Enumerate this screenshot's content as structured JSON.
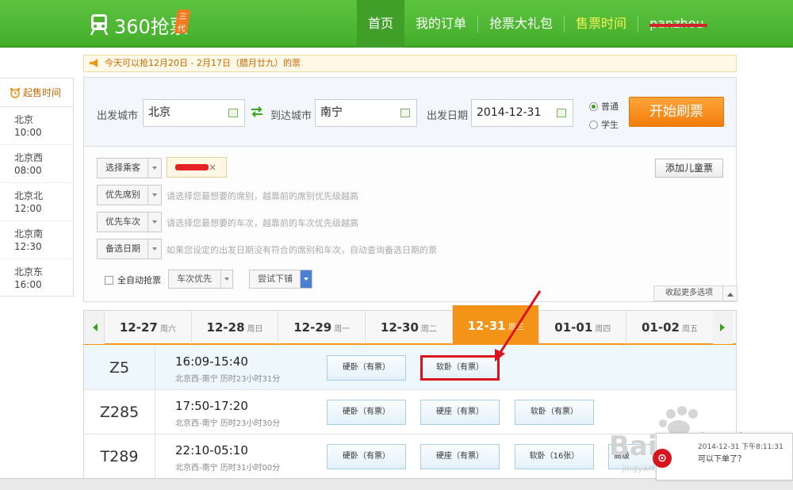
{
  "app": {
    "name": "360抢票",
    "badge": "三代"
  },
  "nav": {
    "items": [
      "首页",
      "我的订单",
      "抢票大礼包",
      "售票时间"
    ],
    "user": "panzhou"
  },
  "notice": {
    "text": "今天可以抢12月20日 - 2月17日（腊月廿九）的票"
  },
  "sale_times": {
    "title": "起售时间",
    "items": [
      {
        "station": "北京",
        "time": "10:00"
      },
      {
        "station": "北京西",
        "time": "08:00"
      },
      {
        "station": "北京北",
        "time": "12:00"
      },
      {
        "station": "北京南",
        "time": "12:30"
      },
      {
        "station": "北京东",
        "time": "16:00"
      }
    ]
  },
  "search": {
    "from_label": "出发城市",
    "from_value": "北京",
    "to_label": "到达城市",
    "to_value": "南宁",
    "date_label": "出发日期",
    "date_value": "2014-12-31",
    "ticket_types": [
      "普通",
      "学生"
    ],
    "ticket_selected": "普通",
    "start_button": "开始刷票"
  },
  "options": {
    "select_passenger": "选择乘客",
    "priority_seat": "优先席别",
    "priority_seat_hint": "请选择您最想要的席别，越靠前的席别优先级越高",
    "priority_train": "优先车次",
    "priority_train_hint": "请选择您最想要的车次，越靠前的车次优先级越高",
    "backup_date": "备选日期",
    "backup_date_hint": "如果您设定的出发日期没有符合的席别和车次，自动查询备选日期的票",
    "add_child": "添加儿童票",
    "auto_grab": "全自动抢票",
    "auto_mode": "车次优先",
    "try_option": "尝试下铺",
    "collapse": "收起更多选项"
  },
  "dates": [
    {
      "date": "12-27",
      "week": "周六"
    },
    {
      "date": "12-28",
      "week": "周日"
    },
    {
      "date": "12-29",
      "week": "周一"
    },
    {
      "date": "12-30",
      "week": "周二"
    },
    {
      "date": "12-31",
      "week": "周三",
      "active": true
    },
    {
      "date": "01-01",
      "week": "周四"
    },
    {
      "date": "01-02",
      "week": "周五"
    }
  ],
  "trains": [
    {
      "no": "Z5",
      "time": "16:09-15:40",
      "route": "北京西-南宁 历时23小时31分",
      "seats": [
        "硬卧（有票）",
        "软卧（有票）"
      ]
    },
    {
      "no": "Z285",
      "time": "17:50-17:20",
      "route": "北京西-南宁 历时23小时30分",
      "seats": [
        "硬卧（有票）",
        "硬座（有票）",
        "软卧（有票）"
      ]
    },
    {
      "no": "T289",
      "time": "22:10-05:10",
      "route": "北京西-南宁 历时31小时00分",
      "seats": [
        "硬卧（有票）",
        "硬座（有票）",
        "软卧（16张）",
        "高级"
      ]
    }
  ],
  "popup": {
    "timestamp": "2014-12-31 下午8:11:31",
    "message": "可以下单了？"
  },
  "watermark": {
    "text": "Baidu经验",
    "url": "jingyan.baidu.com"
  },
  "colors": {
    "brand_green": "#4cb32e",
    "accent_orange": "#f39419",
    "highlight_red": "#d8141c"
  }
}
